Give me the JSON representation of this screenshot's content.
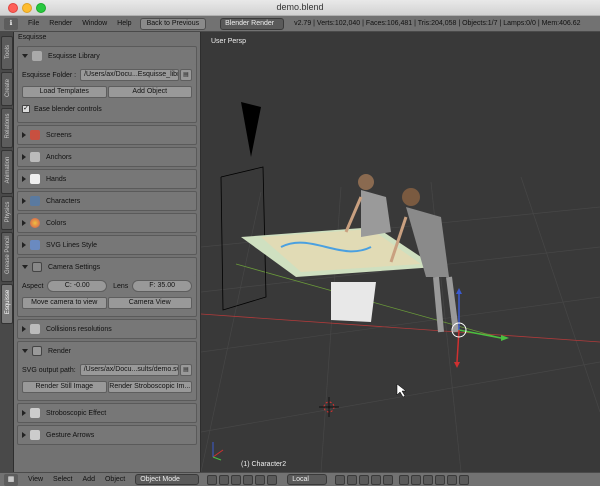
{
  "window": {
    "title": "demo.blend"
  },
  "info_header": {
    "menus": [
      "File",
      "Render",
      "Window",
      "Help"
    ],
    "back_button": "Back to Previous",
    "render_engine": "Blender Render",
    "stats": "v2.79 | Verts:102,040 | Faces:106,481 | Tris:204,058 | Objects:1/7 | Lamps:0/0 | Mem:406.62"
  },
  "tool_tabs": [
    "Tools",
    "Create",
    "Relations",
    "Animation",
    "Physics",
    "Grease Pencil",
    "Esquisse"
  ],
  "shelf": {
    "title": "Esquisse",
    "library": {
      "header": "Esquisse Library",
      "folder_label": "Esquisse Folder :",
      "folder_value": "/Users/ax/Docu...Esquisse_library",
      "load_templates": "Load Templates",
      "add_object": "Add Object",
      "ease_label": "Ease blender controls"
    },
    "panels_a": [
      "Screens",
      "Anchors",
      "Hands",
      "Characters",
      "Colors",
      "SVG Lines Style"
    ],
    "camera": {
      "header": "Camera Settings",
      "aspect_label": "Aspect",
      "aspect_value": "C: -0.00",
      "lens_label": "Lens",
      "lens_value": "F: 35.00",
      "move_camera": "Move camera to view",
      "camera_view": "Camera View"
    },
    "collisions": "Collisions resolutions",
    "render": {
      "header": "Render",
      "svg_label": "SVG output path:",
      "svg_value": "/Users/ax/Docu...sults/demo.svg",
      "still": "Render Still Image",
      "stroboscopic": "Render Stroboscopic Im..."
    },
    "panels_b": [
      "Stroboscopic Effect",
      "Gesture Arrows"
    ]
  },
  "viewport": {
    "label": "User Persp",
    "status": "(1) Character2"
  },
  "bottom_header": {
    "menus": [
      "View",
      "Select",
      "Add",
      "Object"
    ],
    "mode": "Object Mode",
    "pivot": "Local"
  },
  "colors": {
    "panel_bg": "#727272",
    "viewport_bg": "#393939",
    "grid_x": "#b03a3a",
    "grid_y": "#6a9a3a",
    "axis_z": "#3a5ad0"
  }
}
